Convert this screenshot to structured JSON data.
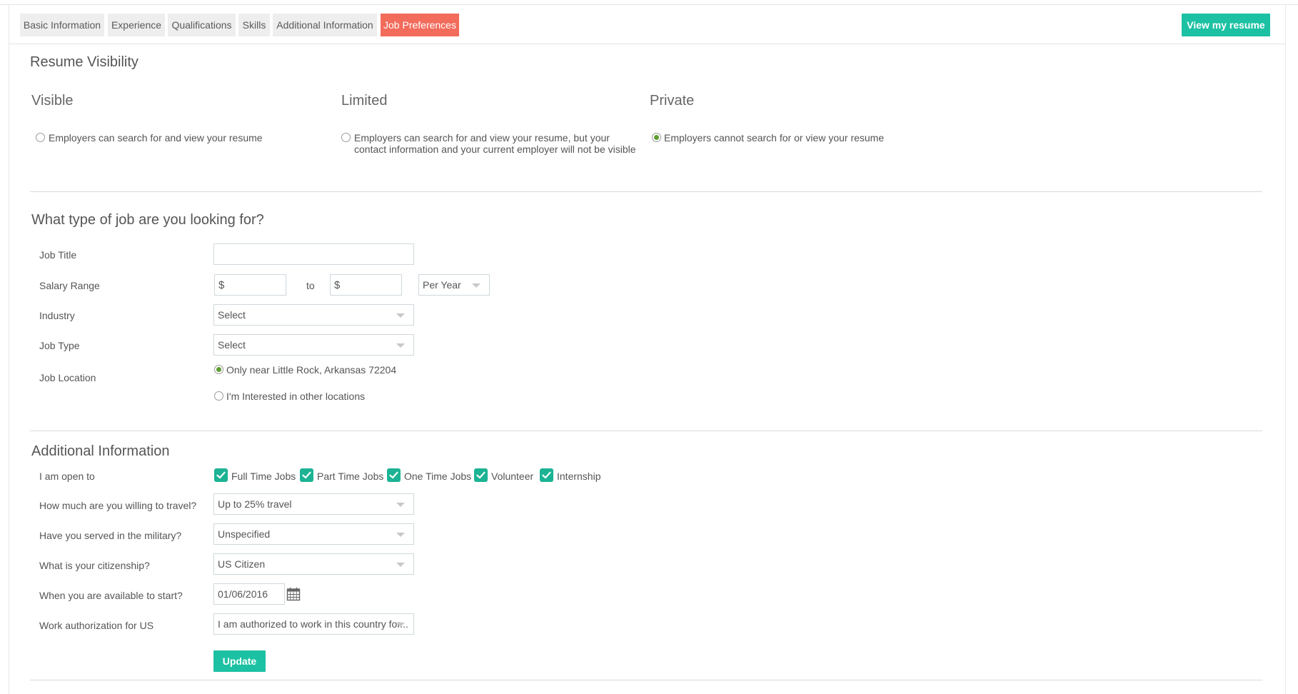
{
  "tabs": [
    {
      "label": "Basic Information",
      "active": false
    },
    {
      "label": "Experience",
      "active": false
    },
    {
      "label": "Qualifications",
      "active": false
    },
    {
      "label": "Skills",
      "active": false
    },
    {
      "label": "Additional Information",
      "active": false
    },
    {
      "label": "Job Preferences",
      "active": true
    }
  ],
  "view_resume_label": "View my resume",
  "visibility": {
    "title": "Resume Visibility",
    "options": [
      {
        "heading": "Visible",
        "text": "Employers can search for and view your resume",
        "selected": false
      },
      {
        "heading": "Limited",
        "text": "Employers can search for and view your resume, but your contact information and your current employer will not be visible",
        "selected": false
      },
      {
        "heading": "Private",
        "text": "Employers cannot search for or view your resume",
        "selected": true
      }
    ]
  },
  "job": {
    "title": "What type of job are you looking for?",
    "job_title_label": "Job Title",
    "job_title_value": "",
    "salary_label": "Salary Range",
    "salary_prefix": "$",
    "salary_to": "to",
    "salary_period": "Per Year",
    "industry_label": "Industry",
    "industry_value": "Select",
    "job_type_label": "Job Type",
    "job_type_value": "Select",
    "location_label": "Job Location",
    "location_options": [
      {
        "text": "Only near Little Rock, Arkansas 72204",
        "selected": true
      },
      {
        "text": "I'm Interested in other locations",
        "selected": false
      }
    ]
  },
  "additional": {
    "title": "Additional Information",
    "open_to_label": "I am open to",
    "open_to": [
      {
        "label": "Full Time Jobs",
        "checked": true
      },
      {
        "label": "Part Time Jobs",
        "checked": true
      },
      {
        "label": "One Time Jobs",
        "checked": true
      },
      {
        "label": "Volunteer",
        "checked": true
      },
      {
        "label": "Internship",
        "checked": true
      }
    ],
    "travel_label": "How much are you willing to travel?",
    "travel_value": "Up to 25% travel",
    "military_label": "Have you served in the military?",
    "military_value": "Unspecified",
    "citizenship_label": "What is your citizenship?",
    "citizenship_value": "US Citizen",
    "start_label": "When you are available to start?",
    "start_value": "01/06/2016",
    "work_auth_label": "Work authorization for US",
    "work_auth_value": "I am authorized to work in this country for..."
  },
  "update_label": "Update",
  "colors": {
    "accent": "#1cc1a3",
    "active_tab": "#f26b5b",
    "radio_selected": "#5c9e31"
  }
}
